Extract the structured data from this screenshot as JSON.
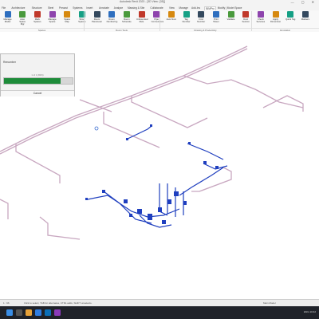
{
  "window": {
    "title": "Autodesk Revit 2023 - [3D View: {3D}]",
    "controls": "— ▢ ✕"
  },
  "tabs": [
    "File",
    "Architecture",
    "Structure",
    "Steel",
    "Precast",
    "Systems",
    "Insert",
    "Annotate",
    "Analyze",
    "Massing & Site",
    "Collaborate",
    "View",
    "Manage",
    "Add-Ins",
    "BIMPro",
    "Modify | Model Space"
  ],
  "active_tab": "BIMPro",
  "ribbon": {
    "buttons": [
      "Manage Model",
      "Auto Space Mgr",
      "Mark Spaces",
      "Manage Space",
      "Space Map",
      "Show Spaces",
      "Room Parameter",
      "Room Numbering",
      "Room Schedule",
      "Unbounded Rule",
      "Pipe Connections",
      "Auto Num",
      "Tag Number",
      "Find Number",
      "Print Sheet",
      "Validate",
      "Duct Section",
      "Check Services",
      "Apply Dimension",
      "Quick Tag",
      "Markers"
    ],
    "panels": [
      "Spaces",
      "Room Tools",
      "Drawing & Productivity",
      "Annotation"
    ]
  },
  "progress": {
    "title": "Renumber",
    "status": "1 of 1 (82%)",
    "fraction": 0.82,
    "cancel_label": "Cancel"
  },
  "statusbar": {
    "left": "1 : 96",
    "hint": "Click to select, TAB for alternates, CTRL adds, SHIFT unselects.",
    "model": "Main Model"
  },
  "taskbar": {
    "tray": "ENG 10:42"
  },
  "colors": {
    "accent": "#1e8c3a",
    "pipe_selected": "#1f3fbf",
    "pipe": "#c8a7c0"
  }
}
